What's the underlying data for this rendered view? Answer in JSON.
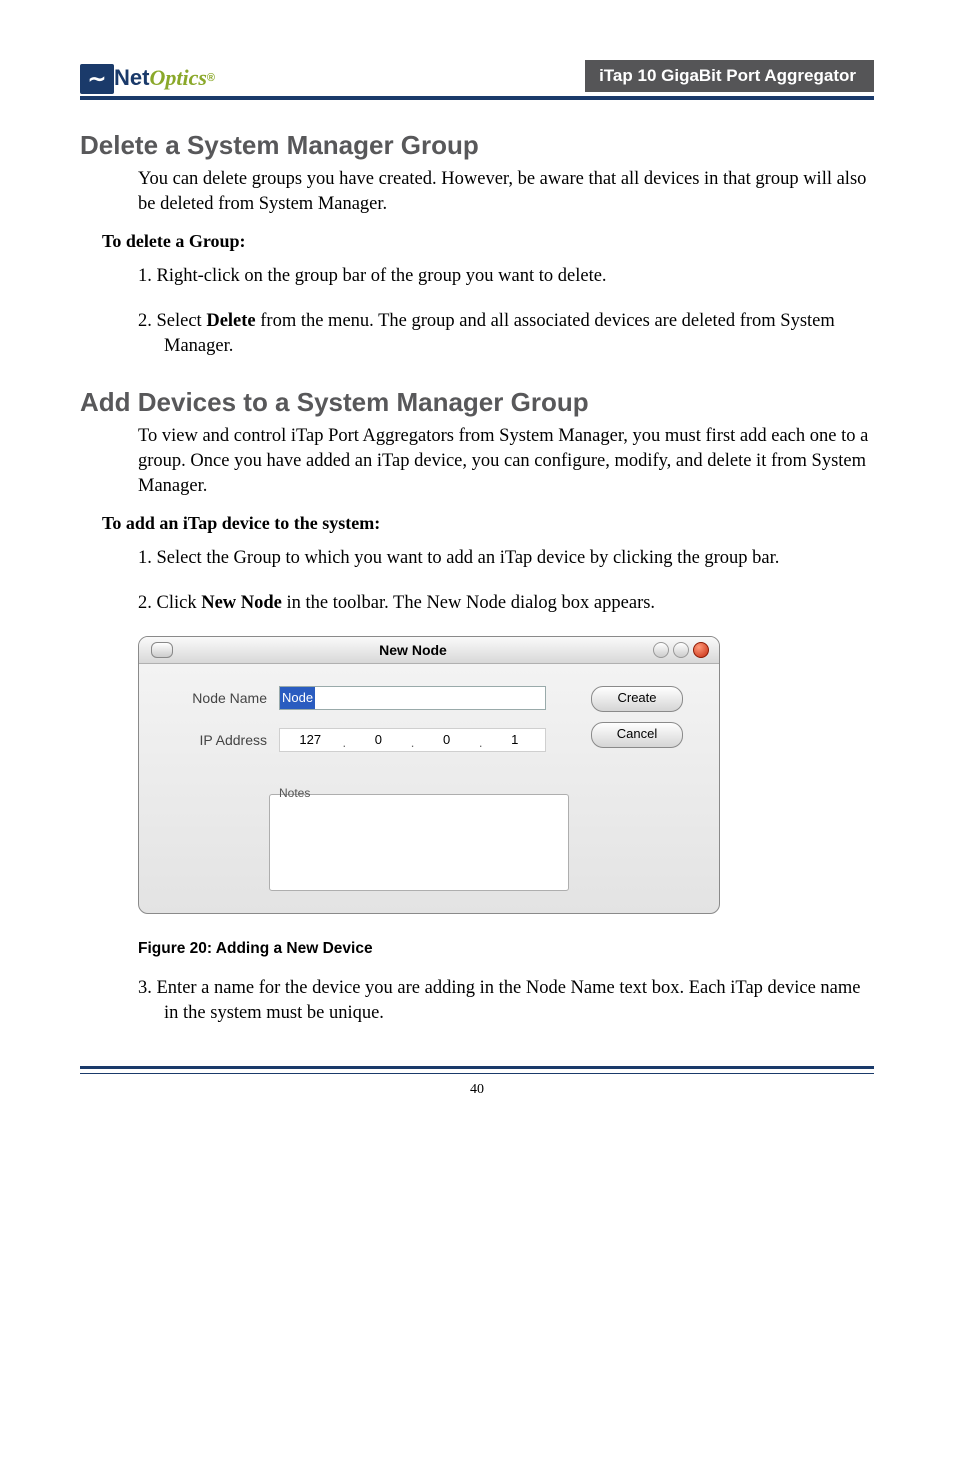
{
  "header": {
    "logo_net": "Net",
    "logo_optics": "Optics",
    "logo_reg": "®",
    "title_box": "iTap 10 GigaBit Port Aggregator"
  },
  "section1": {
    "heading": "Delete a System Manager Group",
    "intro": "You can delete groups you have created. However, be aware that all devices in that group will also be deleted from System Manager.",
    "subhead": "To delete a Group:",
    "steps": [
      "1.  Right-click on the group bar of the group you want to delete.",
      "2.  Select Delete from the menu. The group and all associated devices are deleted from System Manager."
    ],
    "step2_prefix": "2.  Select ",
    "step2_bold": "Delete",
    "step2_suffix": " from the menu. The group and all associated devices are deleted from System Manager."
  },
  "section2": {
    "heading": "Add Devices to a System Manager Group",
    "intro": "To view and control iTap Port Aggregators from System Manager, you must first add each one to a group. Once you have added an iTap device, you can configure, modify, and delete it from System Manager.",
    "subhead": "To add an iTap device to the system:",
    "step1": "1.  Select the Group to which you want to add an iTap device by clicking the group bar.",
    "step2_prefix": "2.  Click ",
    "step2_bold": "New Node",
    "step2_suffix": " in the toolbar. The New Node dialog box appears.",
    "step3": "3.  Enter a name for the device you are adding in the Node Name text box. Each iTap device name in the system must be unique."
  },
  "dialog": {
    "title": "New Node",
    "node_name_label": "Node Name",
    "node_name_value": "Node",
    "ip_label": "IP Address",
    "ip_parts": [
      "127",
      "0",
      "0",
      "1"
    ],
    "notes_label": "Notes",
    "create_btn": "Create",
    "cancel_btn": "Cancel"
  },
  "figure_caption": "Figure 20: Adding a New Device",
  "page_number": "40"
}
